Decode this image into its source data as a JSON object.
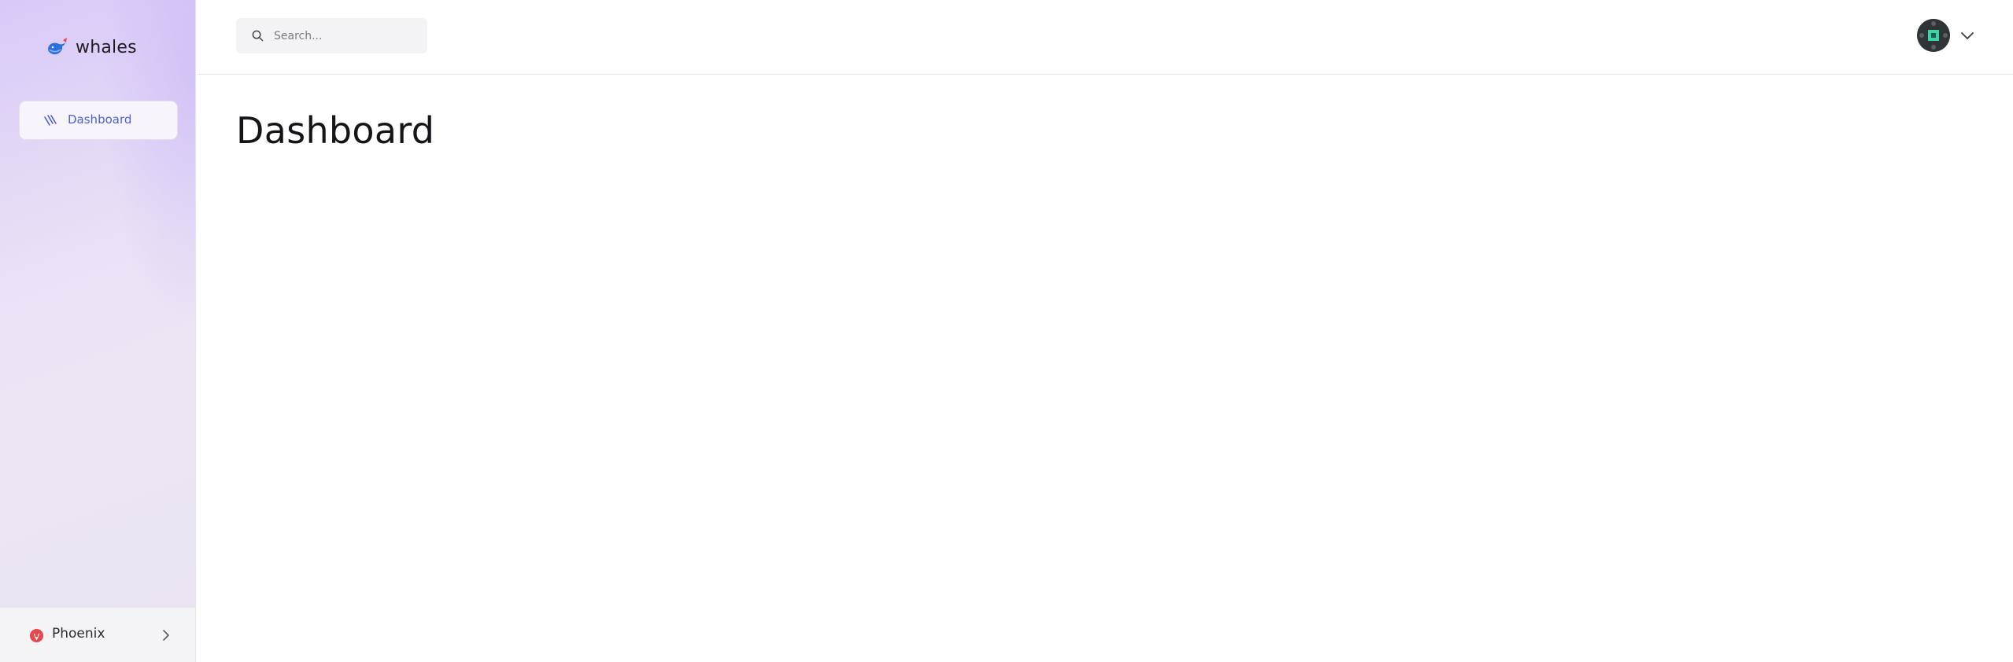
{
  "brand": {
    "name": "whales",
    "logo_icon": "whale-logo-icon"
  },
  "sidebar": {
    "items": [
      {
        "label": "Dashboard",
        "icon": "dashboard-icon",
        "active": true
      }
    ],
    "footer": {
      "org_name": "Phoenix",
      "logo_icon": "phoenix-logo-icon",
      "chevron_icon": "chevron-right-icon"
    }
  },
  "header": {
    "search": {
      "placeholder": "Search...",
      "value": "",
      "icon": "search-icon"
    },
    "user_menu": {
      "avatar_icon": "avatar",
      "chevron_icon": "chevron-down-icon"
    }
  },
  "main": {
    "title": "Dashboard"
  },
  "colors": {
    "accent": "#4a5fd8",
    "sidebar_top": "#d8c9f7",
    "sidebar_bottom": "#e9e4f1",
    "phoenix_brand": "#e5484d"
  }
}
